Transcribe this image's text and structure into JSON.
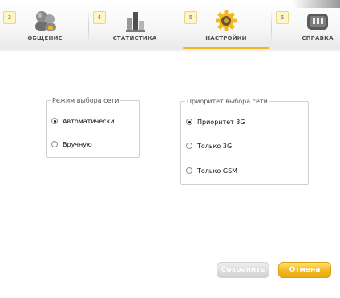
{
  "tabs": [
    {
      "number": "3",
      "label": "ОБЩЕНИЕ",
      "icon": "chat-people-icon",
      "active": false
    },
    {
      "number": "4",
      "label": "СТАТИСТИКА",
      "icon": "statistics-bars-icon",
      "active": false
    },
    {
      "number": "5",
      "label": "НАСТРОЙКИ",
      "icon": "settings-gear-icon",
      "active": true
    },
    {
      "number": "6",
      "label": "СПРАВКА",
      "icon": "help-manual-icon",
      "active": false
    }
  ],
  "network_mode": {
    "legend": "Режим выбора сети",
    "options": [
      {
        "label": "Автоматически",
        "checked": true
      },
      {
        "label": "Вручную",
        "checked": false
      }
    ]
  },
  "network_priority": {
    "legend": "Приоритет выбора сети",
    "options": [
      {
        "label": "Приоритет 3G",
        "checked": true
      },
      {
        "label": "Только 3G",
        "checked": false
      },
      {
        "label": "Только GSM",
        "checked": false
      }
    ]
  },
  "buttons": {
    "save_label": "Сохранить",
    "cancel_label": "Отмена"
  },
  "colors": {
    "accent": "#f2b820",
    "disabled_button": "#d8d8d8"
  }
}
